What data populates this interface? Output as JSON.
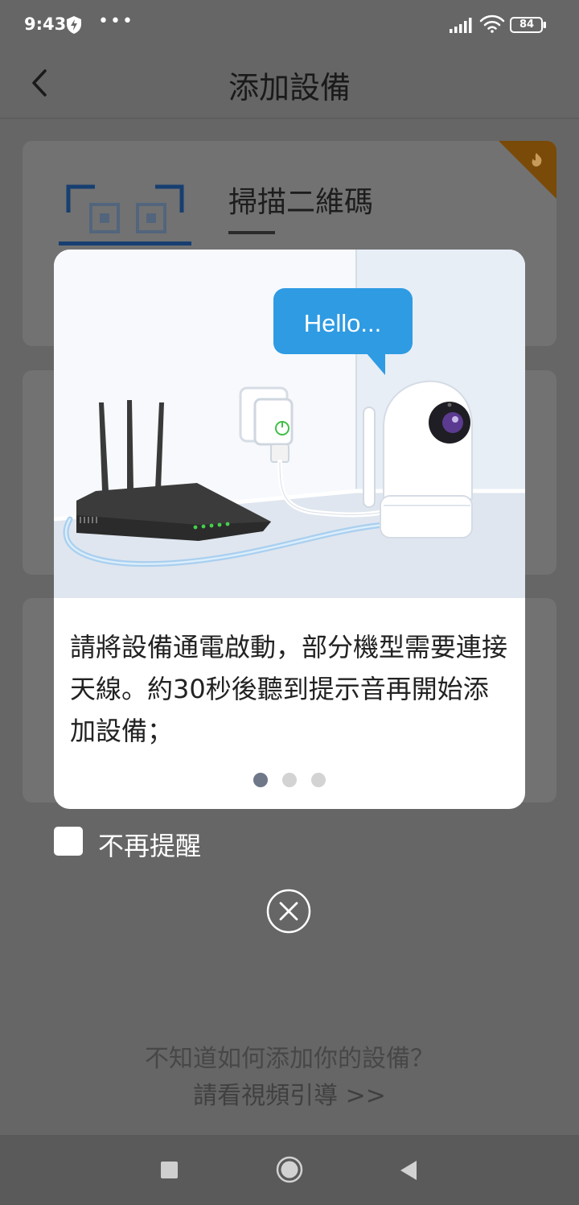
{
  "status_bar": {
    "time": "9:43",
    "more_indicator": "•••",
    "battery_level": "84",
    "icons": [
      "shield-bolt-icon",
      "signal-icon",
      "wifi-icon",
      "battery-icon"
    ]
  },
  "header": {
    "title": "添加設備",
    "back_icon": "chevron-left-icon"
  },
  "cards": [
    {
      "label": "掃描二維碼",
      "icon": "qr-scan-icon",
      "badge_icon": "flame-icon",
      "accent_color": "#173f71",
      "badge_color": "#7a4a08"
    }
  ],
  "modal": {
    "illustration": {
      "speech_bubble": "Hello...",
      "bubble_color": "#2e9be3"
    },
    "tip_text": "請將設備通電啟動，部分機型需要連接天線。約30秒後聽到提示音再開始添加設備；",
    "page_count": 3,
    "active_page": 1
  },
  "no_remind": {
    "label": "不再提醒",
    "checked": false
  },
  "close_icon": "close-circle-icon",
  "help": {
    "question": "不知道如何添加你的設備？",
    "link": "請看視頻引導 >>"
  },
  "nav_bar": {
    "icons": [
      "recents-square-icon",
      "home-circle-icon",
      "back-triangle-icon"
    ]
  }
}
